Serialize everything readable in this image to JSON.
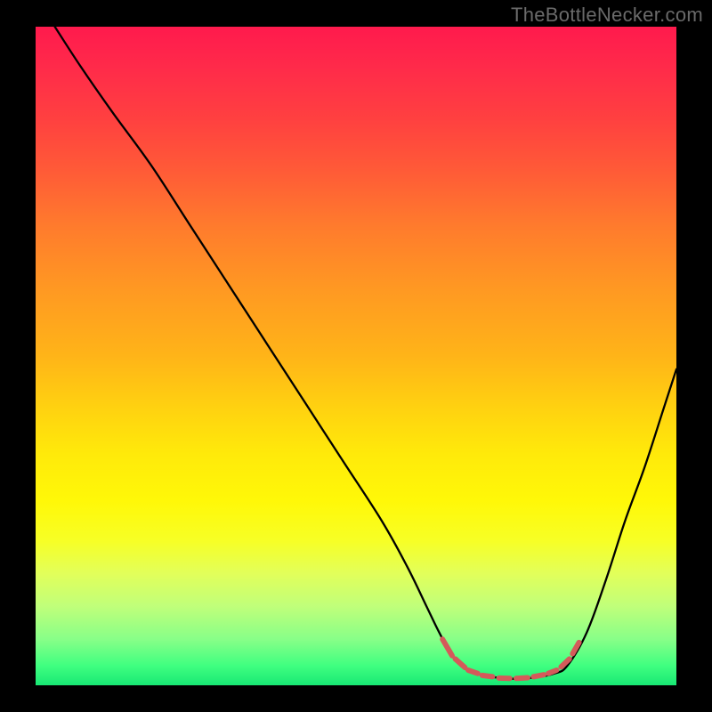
{
  "watermark": "TheBottleNecker.com",
  "chart_data": {
    "type": "line",
    "title": "",
    "xlabel": "",
    "ylabel": "",
    "xlim": [
      0,
      100
    ],
    "ylim": [
      0,
      100
    ],
    "curve": [
      {
        "x": 3,
        "y": 100
      },
      {
        "x": 7,
        "y": 94
      },
      {
        "x": 12,
        "y": 87
      },
      {
        "x": 18,
        "y": 79
      },
      {
        "x": 24,
        "y": 70
      },
      {
        "x": 30,
        "y": 61
      },
      {
        "x": 36,
        "y": 52
      },
      {
        "x": 42,
        "y": 43
      },
      {
        "x": 48,
        "y": 34
      },
      {
        "x": 54,
        "y": 25
      },
      {
        "x": 58,
        "y": 18
      },
      {
        "x": 61,
        "y": 12
      },
      {
        "x": 63,
        "y": 8
      },
      {
        "x": 65,
        "y": 4.5
      },
      {
        "x": 67,
        "y": 2.5
      },
      {
        "x": 70,
        "y": 1.5
      },
      {
        "x": 74,
        "y": 1
      },
      {
        "x": 78,
        "y": 1.2
      },
      {
        "x": 81,
        "y": 1.8
      },
      {
        "x": 83,
        "y": 3
      },
      {
        "x": 86,
        "y": 8
      },
      {
        "x": 89,
        "y": 16
      },
      {
        "x": 92,
        "y": 25
      },
      {
        "x": 95,
        "y": 33
      },
      {
        "x": 98,
        "y": 42
      },
      {
        "x": 100,
        "y": 48
      }
    ],
    "highlight_segments": [
      {
        "x1": 63.5,
        "y1": 7.0,
        "x2": 65.0,
        "y2": 4.5
      },
      {
        "x1": 65.5,
        "y1": 4.0,
        "x2": 67.0,
        "y2": 2.7
      },
      {
        "x1": 67.5,
        "y1": 2.3,
        "x2": 69.0,
        "y2": 1.8
      },
      {
        "x1": 69.7,
        "y1": 1.5,
        "x2": 71.3,
        "y2": 1.3
      },
      {
        "x1": 72.3,
        "y1": 1.1,
        "x2": 74.0,
        "y2": 1.05
      },
      {
        "x1": 75.0,
        "y1": 1.05,
        "x2": 76.8,
        "y2": 1.15
      },
      {
        "x1": 77.7,
        "y1": 1.3,
        "x2": 79.3,
        "y2": 1.6
      },
      {
        "x1": 80.0,
        "y1": 1.8,
        "x2": 81.3,
        "y2": 2.3
      },
      {
        "x1": 82.0,
        "y1": 2.8,
        "x2": 83.3,
        "y2": 4.0
      },
      {
        "x1": 83.8,
        "y1": 4.8,
        "x2": 84.8,
        "y2": 6.5
      }
    ],
    "highlight_color": "#d45a5a"
  }
}
